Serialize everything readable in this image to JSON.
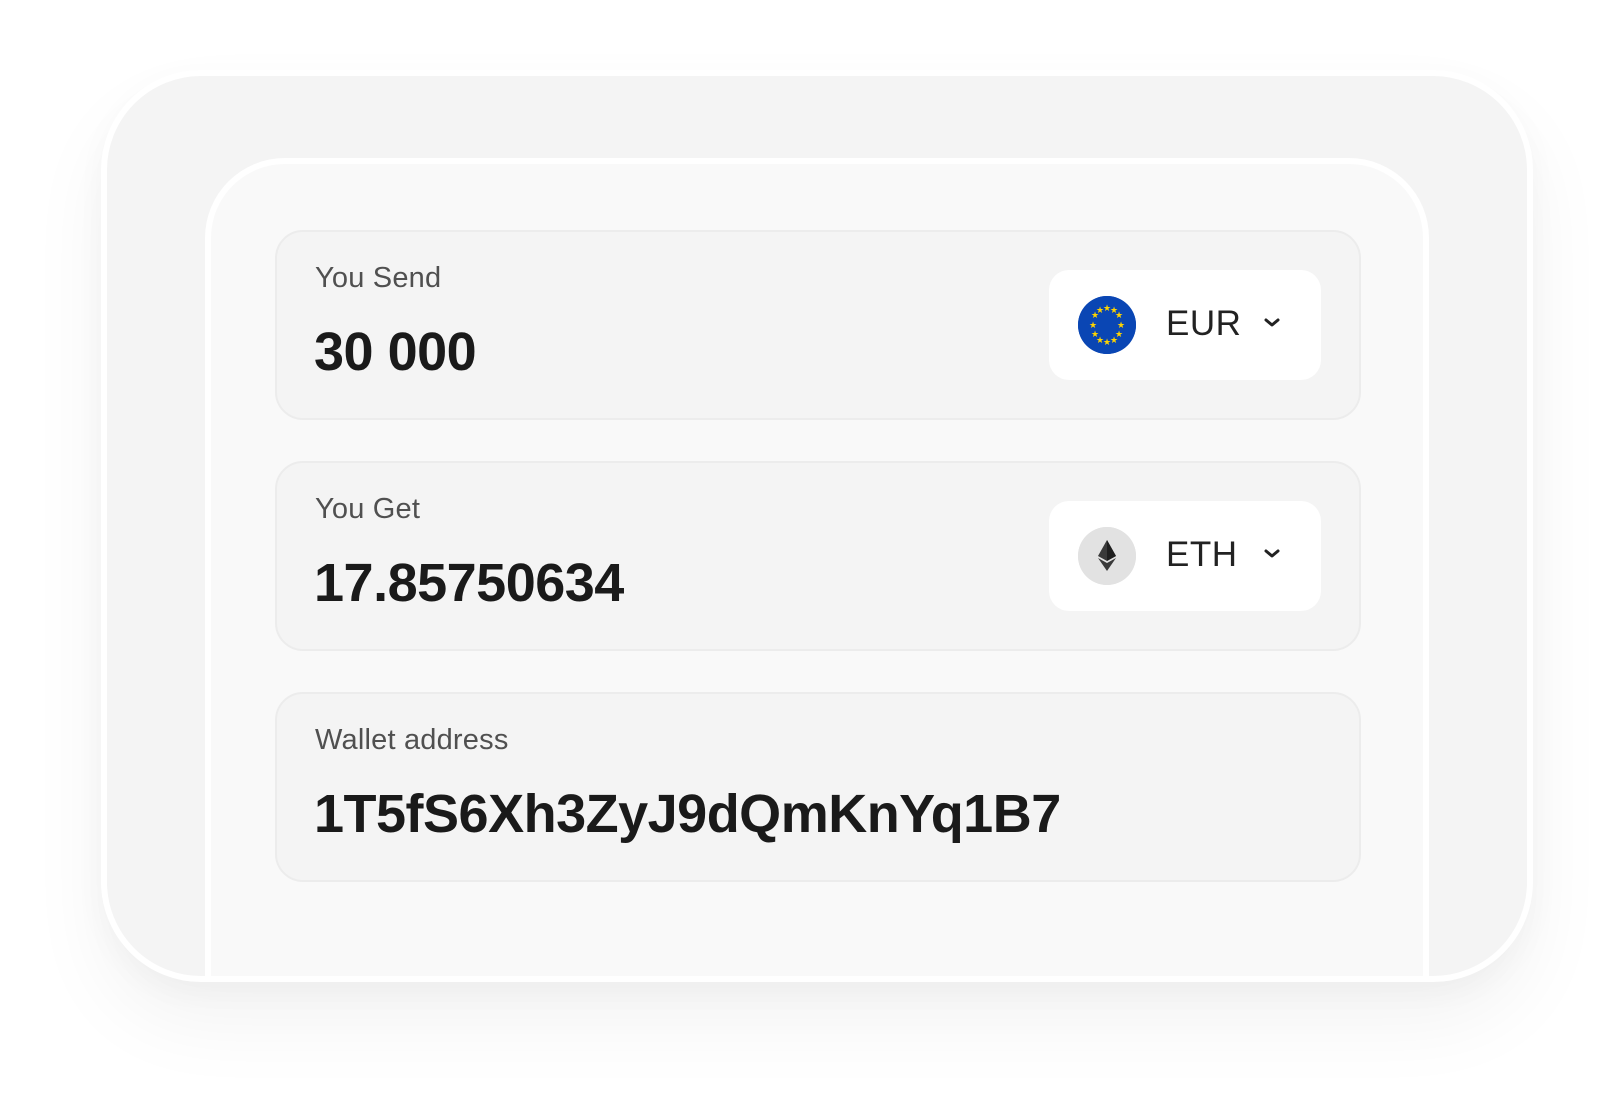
{
  "send": {
    "label": "You Send",
    "value": "30 000",
    "currency": "EUR",
    "currency_icon": "eu-flag-icon"
  },
  "get": {
    "label": "You Get",
    "value": "17.85750634",
    "currency": "ETH",
    "currency_icon": "ethereum-icon"
  },
  "wallet": {
    "label": "Wallet address",
    "value": "1T5fS6Xh3ZyJ9dQmKnYq1B7"
  },
  "colors": {
    "eu_blue": "#0a46b4",
    "eu_star": "#ffd400",
    "eth_bg": "#e2e2e2",
    "eth_glyph": "#3a3a3a"
  }
}
